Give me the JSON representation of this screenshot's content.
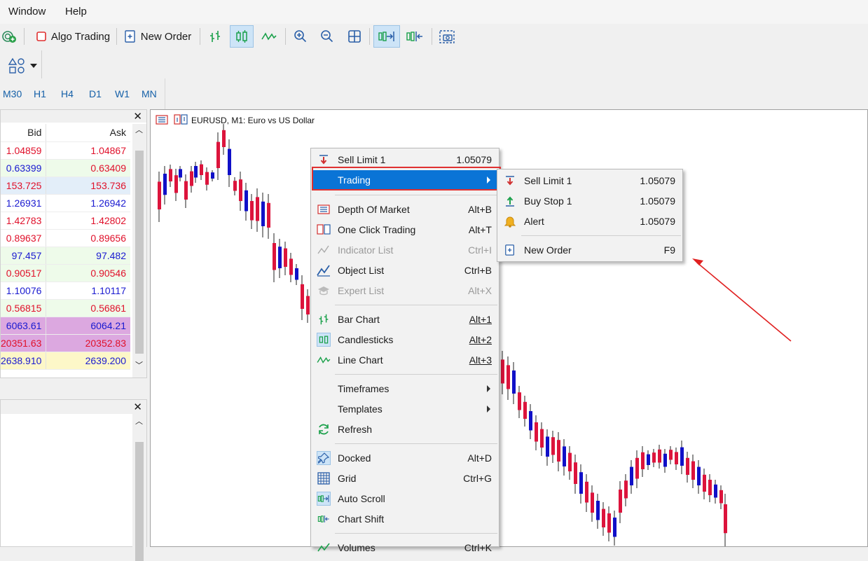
{
  "menubar": {
    "window": "Window",
    "help": "Help"
  },
  "toolbar": {
    "algo_trading": "Algo Trading",
    "new_order": "New Order"
  },
  "timeframes": [
    "M30",
    "H1",
    "H4",
    "D1",
    "W1",
    "MN"
  ],
  "market_watch": {
    "columns": {
      "bid": "Bid",
      "ask": "Ask"
    },
    "rows": [
      {
        "bid": "1.04859",
        "ask": "1.04867",
        "bid_color": "#e0102a",
        "ask_color": "#e0102a",
        "bg": "#ffffff"
      },
      {
        "bid": "0.63399",
        "ask": "0.63409",
        "bid_color": "#1a1ad0",
        "ask_color": "#e0102a",
        "bg": "#eefbea"
      },
      {
        "bid": "153.725",
        "ask": "153.736",
        "bid_color": "#e0102a",
        "ask_color": "#e0102a",
        "bg": "#e3eef9"
      },
      {
        "bid": "1.26931",
        "ask": "1.26942",
        "bid_color": "#1a1ad0",
        "ask_color": "#1a1ad0",
        "bg": "#ffffff"
      },
      {
        "bid": "1.42783",
        "ask": "1.42802",
        "bid_color": "#e0102a",
        "ask_color": "#e0102a",
        "bg": "#ffffff"
      },
      {
        "bid": "0.89637",
        "ask": "0.89656",
        "bid_color": "#e0102a",
        "ask_color": "#e0102a",
        "bg": "#ffffff"
      },
      {
        "bid": "97.457",
        "ask": "97.482",
        "bid_color": "#1a1ad0",
        "ask_color": "#1a1ad0",
        "bg": "#eefbea"
      },
      {
        "bid": "0.90517",
        "ask": "0.90546",
        "bid_color": "#e0102a",
        "ask_color": "#e0102a",
        "bg": "#eefbea"
      },
      {
        "bid": "1.10076",
        "ask": "1.10117",
        "bid_color": "#1a1ad0",
        "ask_color": "#1a1ad0",
        "bg": "#ffffff"
      },
      {
        "bid": "0.56815",
        "ask": "0.56861",
        "bid_color": "#e0102a",
        "ask_color": "#e0102a",
        "bg": "#eefbea"
      },
      {
        "bid": "6063.61",
        "ask": "6064.21",
        "bid_color": "#1a1ad0",
        "ask_color": "#1a1ad0",
        "bg": "#dca8e0"
      },
      {
        "bid": "20351.63",
        "ask": "20352.83",
        "bid_color": "#e0102a",
        "ask_color": "#e0102a",
        "bg": "#dca8e0"
      },
      {
        "bid": "2638.910",
        "ask": "2639.200",
        "bid_color": "#1a1ad0",
        "ask_color": "#1a1ad0",
        "bg": "#fdf7c8"
      }
    ]
  },
  "chart": {
    "title": "EURUSD, M1:  Euro vs US Dollar"
  },
  "context_menu": {
    "sell_limit": {
      "label": "Sell Limit 1",
      "value": "1.05079"
    },
    "trading": "Trading",
    "depth_of_market": {
      "label": "Depth Of Market",
      "shortcut": "Alt+B"
    },
    "one_click_trading": {
      "label": "One Click Trading",
      "shortcut": "Alt+T"
    },
    "indicator_list": {
      "label": "Indicator List",
      "shortcut": "Ctrl+I"
    },
    "object_list": {
      "label": "Object List",
      "shortcut": "Ctrl+B"
    },
    "expert_list": {
      "label": "Expert List",
      "shortcut": "Alt+X"
    },
    "bar_chart": {
      "label": "Bar Chart",
      "shortcut": "Alt+1"
    },
    "candlesticks": {
      "label": "Candlesticks",
      "shortcut": "Alt+2"
    },
    "line_chart": {
      "label": "Line Chart",
      "shortcut": "Alt+3"
    },
    "timeframes": "Timeframes",
    "templates": "Templates",
    "refresh": "Refresh",
    "docked": {
      "label": "Docked",
      "shortcut": "Alt+D"
    },
    "grid": {
      "label": "Grid",
      "shortcut": "Ctrl+G"
    },
    "auto_scroll": "Auto Scroll",
    "chart_shift": "Chart Shift",
    "volumes": {
      "label": "Volumes",
      "shortcut": "Ctrl+K"
    }
  },
  "submenu": {
    "sell_limit": {
      "label": "Sell Limit 1",
      "value": "1.05079"
    },
    "buy_stop": {
      "label": "Buy Stop 1",
      "value": "1.05079"
    },
    "alert": {
      "label": "Alert",
      "value": "1.05079"
    },
    "new_order": {
      "label": "New Order",
      "shortcut": "F9"
    }
  },
  "colors": {
    "bull": "#1010c8",
    "bear": "#dc143c",
    "highlight": "#0a74d6",
    "annotation": "#e02020"
  }
}
